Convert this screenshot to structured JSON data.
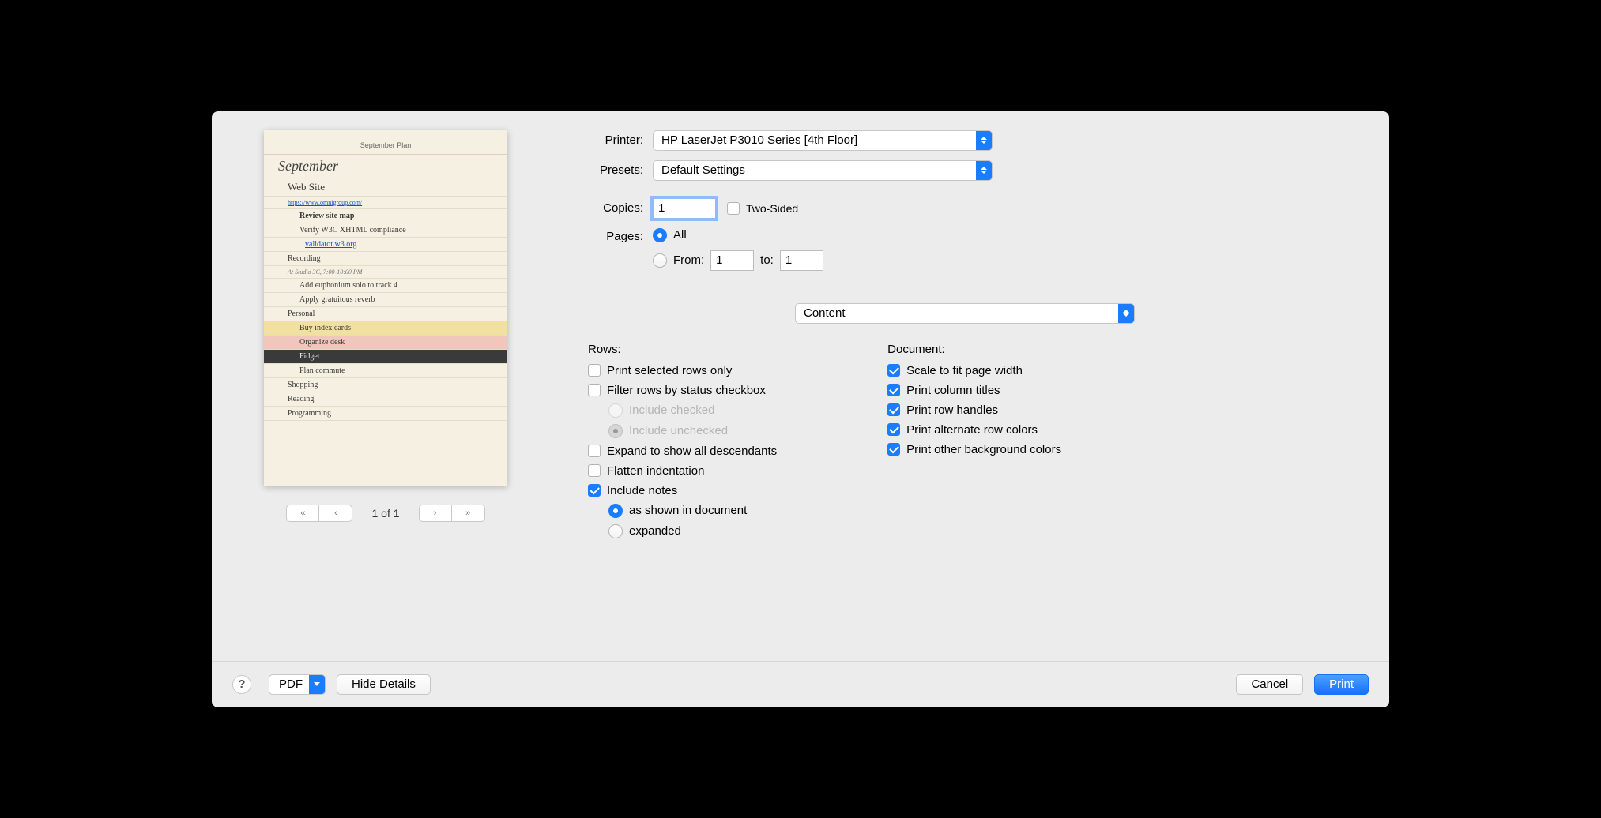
{
  "printer": {
    "label": "Printer:",
    "value": "HP LaserJet P3010 Series [4th Floor]"
  },
  "presets": {
    "label": "Presets:",
    "value": "Default Settings"
  },
  "copies": {
    "label": "Copies:",
    "value": "1"
  },
  "twoSided": {
    "label": "Two-Sided",
    "checked": false
  },
  "pages": {
    "label": "Pages:",
    "all": {
      "label": "All",
      "selected": true
    },
    "range": {
      "label": "From:",
      "to_label": "to:",
      "from": "1",
      "to": "1",
      "selected": false
    }
  },
  "panel": {
    "value": "Content"
  },
  "rows": {
    "title": "Rows:",
    "selectedOnly": {
      "label": "Print selected rows only",
      "checked": false
    },
    "filterStatus": {
      "label": "Filter rows by status checkbox",
      "checked": false
    },
    "includeChecked": {
      "label": "Include checked",
      "selected": false,
      "disabled": true
    },
    "includeUnchecked": {
      "label": "Include unchecked",
      "selected": true,
      "disabled": true
    },
    "expandDesc": {
      "label": "Expand to show all descendants",
      "checked": false
    },
    "flatten": {
      "label": "Flatten indentation",
      "checked": false
    },
    "includeNotes": {
      "label": "Include notes",
      "checked": true
    },
    "notesShown": {
      "label": "as shown in document",
      "selected": true
    },
    "notesExpanded": {
      "label": "expanded",
      "selected": false
    }
  },
  "document": {
    "title": "Document:",
    "scaleFit": {
      "label": "Scale to fit page width",
      "checked": true
    },
    "colTitles": {
      "label": "Print column titles",
      "checked": true
    },
    "rowHandles": {
      "label": "Print row handles",
      "checked": true
    },
    "altColors": {
      "label": "Print alternate row colors",
      "checked": true
    },
    "bgColors": {
      "label": "Print other background colors",
      "checked": true
    }
  },
  "pager": {
    "label": "1 of 1"
  },
  "footer": {
    "pdf": "PDF",
    "hide": "Hide Details",
    "cancel": "Cancel",
    "print": "Print"
  },
  "preview": {
    "header": "September Plan",
    "title": "September",
    "lines": [
      {
        "text": "Web Site",
        "cls": "indent1",
        "style": "font-family:Georgia; font-size:13px;"
      },
      {
        "text": "https://www.omnigroup.com/",
        "cls": "indent1 link",
        "style": "font-size:8px;"
      },
      {
        "text": "Review site map",
        "cls": "indent2 bold"
      },
      {
        "text": "Verify W3C XHTML compliance",
        "cls": "indent2"
      },
      {
        "text": "validator.w3.org",
        "cls": "indent3 link"
      },
      {
        "text": "Recording",
        "cls": "indent1"
      },
      {
        "text": "At Studio 3C, 7:00-10:00 PM",
        "cls": "indent1 note"
      },
      {
        "text": "Add euphonium solo to track 4",
        "cls": "indent2"
      },
      {
        "text": "Apply gratuitous reverb",
        "cls": "indent2"
      },
      {
        "text": "Personal",
        "cls": "indent1"
      },
      {
        "text": "Buy index cards",
        "cls": "indent2",
        "row": "row-yellow"
      },
      {
        "text": "Organize desk",
        "cls": "indent2",
        "row": "row-pink"
      },
      {
        "text": "Fidget",
        "cls": "indent2",
        "row": "row-dark"
      },
      {
        "text": "Plan commute",
        "cls": "indent2"
      },
      {
        "text": "Shopping",
        "cls": "indent1"
      },
      {
        "text": "Reading",
        "cls": "indent1"
      },
      {
        "text": "Programming",
        "cls": "indent1"
      }
    ]
  }
}
